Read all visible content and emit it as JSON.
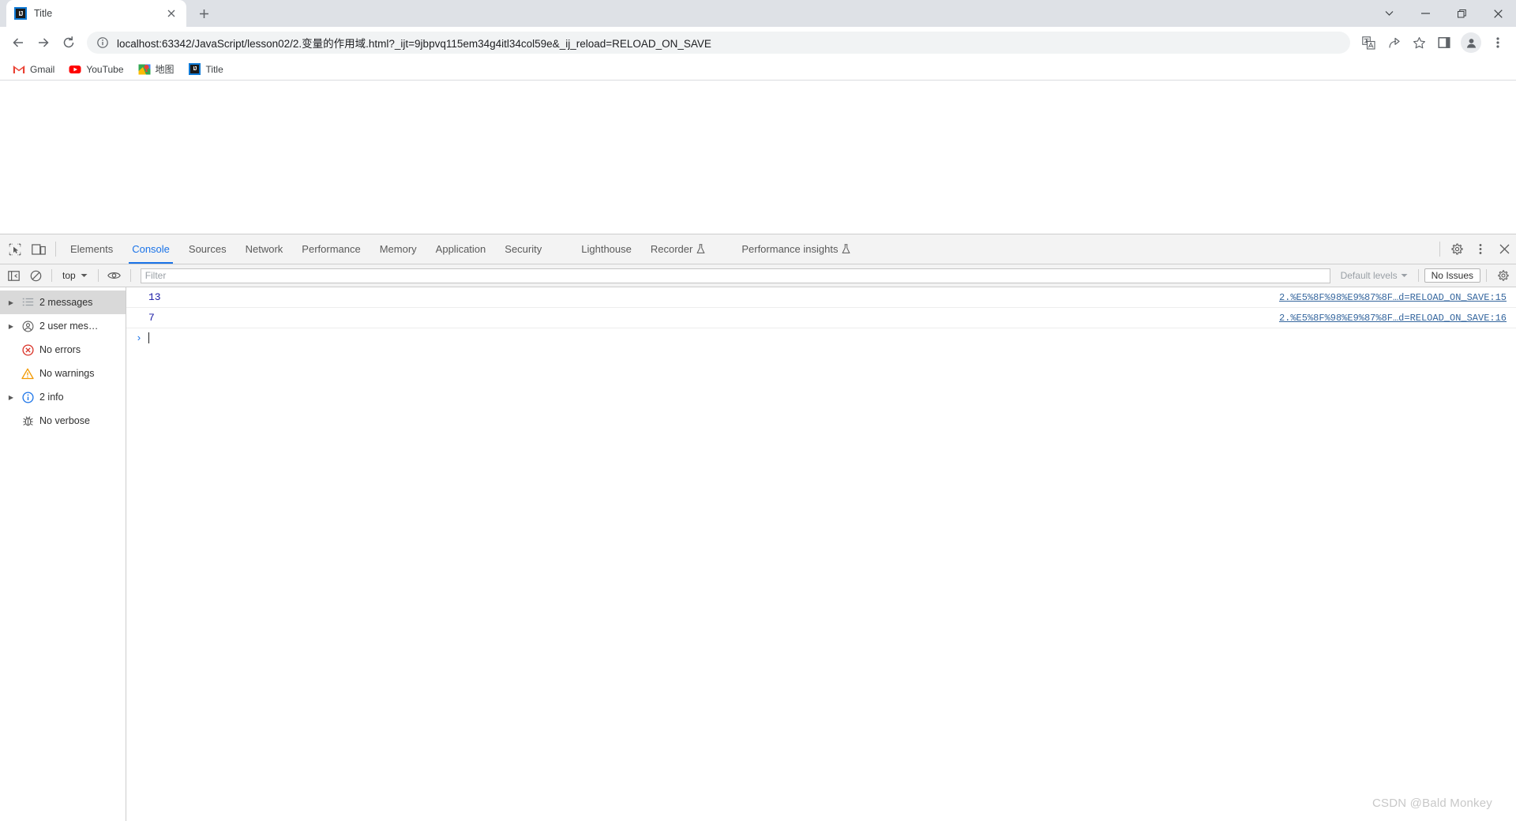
{
  "window": {
    "controls": [
      {
        "name": "tab-search",
        "glyph": "chevron-down"
      },
      {
        "name": "minimize",
        "glyph": "minimize"
      },
      {
        "name": "maximize",
        "glyph": "restore"
      },
      {
        "name": "close",
        "glyph": "close"
      }
    ]
  },
  "tabs": [
    {
      "title": "Title",
      "favicon": "intellij-idea-icon",
      "favicon_text": "IJ",
      "active": true
    }
  ],
  "newtab_label": "+",
  "toolbar": {
    "back_icon": "back-arrow-icon",
    "forward_icon": "forward-arrow-icon",
    "reload_icon": "reload-icon",
    "url_host": "localhost:63342",
    "url_path": "/JavaScript/lesson02/2.变量的作用域.html?_ijt=9jbpvq115em34g4itl34col59e&_ij_reload=RELOAD_ON_SAVE",
    "url_full": "localhost:63342/JavaScript/lesson02/2.变量的作用域.html?_ijt=9jbpvq115em34g4itl34col59e&_ij_reload=RELOAD_ON_SAVE",
    "site_info_icon": "info-circle-icon",
    "right_icons": [
      "translate-icon",
      "share-icon",
      "bookmark-star-icon",
      "side-panel-icon",
      "profile-avatar-icon",
      "chrome-menu-icon"
    ]
  },
  "bookmarks": [
    {
      "label": "Gmail",
      "icon": "gmail-icon"
    },
    {
      "label": "YouTube",
      "icon": "youtube-icon"
    },
    {
      "label": "地图",
      "icon": "google-maps-icon"
    },
    {
      "label": "Title",
      "icon": "intellij-idea-icon"
    }
  ],
  "devtools": {
    "inspect_icon": "inspect-element-icon",
    "device_icon": "device-toolbar-icon",
    "tabs": [
      {
        "label": "Elements",
        "active": false,
        "experimental": false
      },
      {
        "label": "Console",
        "active": true,
        "experimental": false
      },
      {
        "label": "Sources",
        "active": false,
        "experimental": false
      },
      {
        "label": "Network",
        "active": false,
        "experimental": false
      },
      {
        "label": "Performance",
        "active": false,
        "experimental": false
      },
      {
        "label": "Memory",
        "active": false,
        "experimental": false
      },
      {
        "label": "Application",
        "active": false,
        "experimental": false
      },
      {
        "label": "Security",
        "active": false,
        "experimental": false
      },
      {
        "label": "Lighthouse",
        "active": false,
        "experimental": false
      },
      {
        "label": "Recorder",
        "active": false,
        "experimental": true
      },
      {
        "label": "Performance insights",
        "active": false,
        "experimental": true
      }
    ],
    "tabbar_right_icons": [
      "settings-gear-icon",
      "more-options-icon",
      "close-devtools-icon"
    ],
    "filterbar": {
      "sidebar_toggle_icon": "console-sidebar-toggle-icon",
      "clear_console_icon": "clear-console-icon",
      "context_value": "top",
      "eye_icon": "live-expression-eye-icon",
      "filter_placeholder": "Filter",
      "filter_value": "",
      "levels_label": "Default levels",
      "issues_label": "No Issues",
      "settings_icon": "console-settings-gear-icon"
    },
    "sidebar": [
      {
        "label": "2 messages",
        "icon": "list-icon",
        "expandable": true,
        "selected": true
      },
      {
        "label": "2 user mes…",
        "icon": "user-message-icon",
        "expandable": true,
        "selected": false
      },
      {
        "label": "No errors",
        "icon": "error-circle-icon",
        "expandable": false,
        "selected": false
      },
      {
        "label": "No warnings",
        "icon": "warning-triangle-icon",
        "expandable": false,
        "selected": false
      },
      {
        "label": "2 info",
        "icon": "info-circle-icon",
        "expandable": true,
        "selected": false
      },
      {
        "label": "No verbose",
        "icon": "bug-icon",
        "expandable": false,
        "selected": false
      }
    ],
    "messages": [
      {
        "value": "13",
        "source": "2.%E5%8F%98%E9%87%8F…d=RELOAD_ON_SAVE:15"
      },
      {
        "value": "7",
        "source": "2.%E5%8F%98%E9%87%8F…d=RELOAD_ON_SAVE:16"
      }
    ],
    "prompt": {
      "caret": "›",
      "value": ""
    }
  },
  "watermark": "CSDN @Bald Monkey",
  "colors": {
    "accent": "#1a73e8",
    "tabstrip_bg": "#dee1e6",
    "devtools_bg": "#f3f3f3",
    "console_number": "#1a1aa6",
    "source_link": "#35669e",
    "error_red": "#d93025",
    "warning_orange": "#f29900",
    "info_blue": "#1a73e8"
  }
}
